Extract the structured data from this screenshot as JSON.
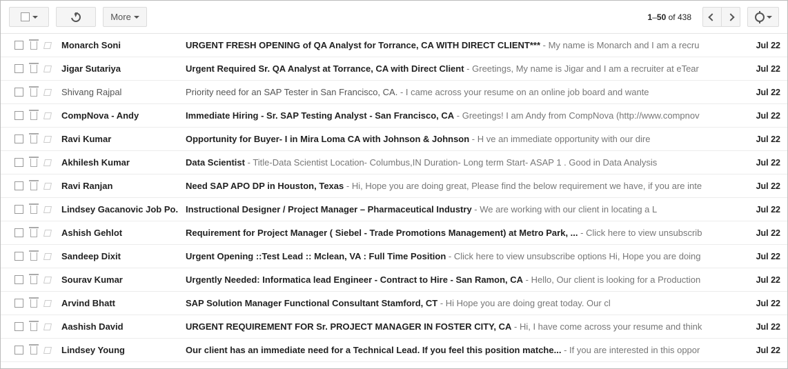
{
  "toolbar": {
    "more_label": "More",
    "range_start": "1",
    "range_end": "50",
    "range_of_label": " of ",
    "total": "438"
  },
  "emails": [
    {
      "sender": "Monarch Soni",
      "subject": "URGENT FRESH OPENING of QA Analyst for Torrance, CA WITH DIRECT CLIENT***",
      "snippet": "My name is Monarch and I am a recru",
      "date": "Jul 22",
      "read": false
    },
    {
      "sender": "Jigar Sutariya",
      "subject": "Urgent Required Sr. QA Analyst at Torrance, CA with Direct Client",
      "snippet": "Greetings, My name is Jigar and I am a recruiter at eTear",
      "date": "Jul 22",
      "read": false
    },
    {
      "sender": "Shivang Rajpal",
      "subject": "Priority need for an SAP Tester in San Francisco, CA.",
      "snippet": "I came across your resume on an online job board and wante",
      "date": "Jul 22",
      "read": true
    },
    {
      "sender": "CompNova - Andy",
      "subject": "Immediate Hiring - Sr. SAP Testing Analyst - San Francisco, CA",
      "snippet": "Greetings! I am Andy from CompNova (http://www.compnov",
      "date": "Jul 22",
      "read": false
    },
    {
      "sender": "Ravi Kumar",
      "subject": "Opportunity for Buyer- I in Mira Loma CA with Johnson & Johnson",
      "snippet": "H          ve an immediate opportunity with our dire",
      "date": "Jul 22",
      "read": false
    },
    {
      "sender": "Akhilesh Kumar",
      "subject": "Data Scientist",
      "snippet": "Title-Data Scientist Location- Columbus,IN Duration- Long term Start- ASAP 1 . Good in Data Analysis",
      "date": "Jul 22",
      "read": false
    },
    {
      "sender": "Ravi Ranjan",
      "subject": "Need SAP APO DP in Houston, Texas",
      "snippet": "Hi, Hope you are doing great, Please find the below requirement we have, if you are inte",
      "date": "Jul 22",
      "read": false
    },
    {
      "sender": "Lindsey Gacanovic Job Po.",
      "subject": "Instructional Designer / Project Manager – Pharmaceutical Industry",
      "snippet": "          We are working with our client in locating a L",
      "date": "Jul 22",
      "read": false
    },
    {
      "sender": "Ashish Gehlot",
      "subject": "Requirement for Project Manager ( Siebel - Trade Promotions Management) at Metro Park, ...",
      "snippet": "Click here to view unsubscrib",
      "date": "Jul 22",
      "read": false
    },
    {
      "sender": "Sandeep Dixit",
      "subject": "Urgent Opening ::Test Lead :: Mclean, VA : Full Time Position",
      "snippet": "Click here to view unsubscribe options Hi, Hope you are doing",
      "date": "Jul 22",
      "read": false
    },
    {
      "sender": "Sourav Kumar",
      "subject": "Urgently Needed: Informatica lead Engineer - Contract to Hire - San Ramon, CA",
      "snippet": "Hello, Our client is looking for a Production",
      "date": "Jul 22",
      "read": false
    },
    {
      "sender": "Arvind Bhatt",
      "subject": "SAP Solution Manager Functional Consultant Stamford, CT",
      "snippet": "Hi                            Hope you are doing great today. Our cl",
      "date": "Jul 22",
      "read": false
    },
    {
      "sender": "Aashish David",
      "subject": "URGENT REQUIREMENT FOR Sr. PROJECT MANAGER IN FOSTER CITY, CA",
      "snippet": "Hi, I have come across your resume and think",
      "date": "Jul 22",
      "read": false
    },
    {
      "sender": "Lindsey Young",
      "subject": "Our client has an immediate need for a Technical Lead. If you feel this position matche...",
      "snippet": "If you are interested in this oppor",
      "date": "Jul 22",
      "read": false
    }
  ]
}
